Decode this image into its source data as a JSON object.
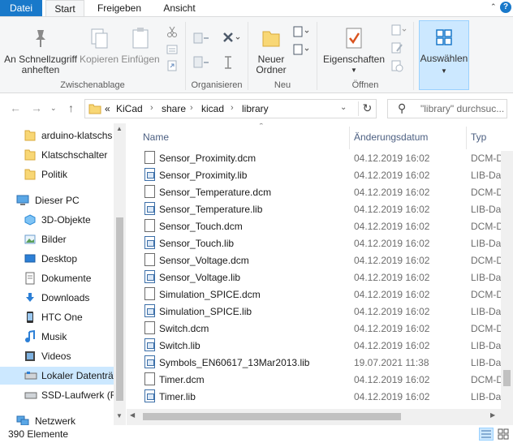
{
  "tabs": {
    "file": "Datei",
    "start": "Start",
    "share": "Freigeben",
    "view": "Ansicht"
  },
  "ribbon": {
    "pin": "An Schnellzugriff anheften",
    "copy": "Kopieren",
    "paste": "Einfügen",
    "clipboard_group": "Zwischenablage",
    "organize_group": "Organisieren",
    "new_folder": "Neuer Ordner",
    "new_group": "Neu",
    "properties": "Eigenschaften",
    "open_group": "Öffnen",
    "select": "Auswählen"
  },
  "address": {
    "overflow": "«",
    "crumbs": [
      "KiCad",
      "share",
      "kicad",
      "library"
    ],
    "search_placeholder": "\"library\" durchsuc..."
  },
  "nav": {
    "items": [
      {
        "label": "arduino-klatschs",
        "icon": "folder-icon"
      },
      {
        "label": "Klatschschalter",
        "icon": "folder-icon"
      },
      {
        "label": "Politik",
        "icon": "folder-icon"
      },
      {
        "label": "Dieser PC",
        "icon": "computer-icon"
      },
      {
        "label": "3D-Objekte",
        "icon": "cube-icon"
      },
      {
        "label": "Bilder",
        "icon": "pictures-icon"
      },
      {
        "label": "Desktop",
        "icon": "desktop-icon"
      },
      {
        "label": "Dokumente",
        "icon": "documents-icon"
      },
      {
        "label": "Downloads",
        "icon": "download-icon"
      },
      {
        "label": "HTC One",
        "icon": "phone-icon"
      },
      {
        "label": "Musik",
        "icon": "music-icon"
      },
      {
        "label": "Videos",
        "icon": "video-icon"
      },
      {
        "label": "Lokaler Datenträ",
        "icon": "drive-icon"
      },
      {
        "label": "SSD-Laufwerk (F",
        "icon": "drive-icon"
      },
      {
        "label": "Netzwerk",
        "icon": "network-icon"
      }
    ]
  },
  "columns": {
    "name": "Name",
    "date": "Änderungsdatum",
    "type": "Typ"
  },
  "files": [
    {
      "name": "Sensor_Proximity.dcm",
      "date": "04.12.2019 16:02",
      "type": "DCM-Datei",
      "kind": "dcm"
    },
    {
      "name": "Sensor_Proximity.lib",
      "date": "04.12.2019 16:02",
      "type": "LIB-Datei",
      "kind": "lib"
    },
    {
      "name": "Sensor_Temperature.dcm",
      "date": "04.12.2019 16:02",
      "type": "DCM-Datei",
      "kind": "dcm"
    },
    {
      "name": "Sensor_Temperature.lib",
      "date": "04.12.2019 16:02",
      "type": "LIB-Datei",
      "kind": "lib"
    },
    {
      "name": "Sensor_Touch.dcm",
      "date": "04.12.2019 16:02",
      "type": "DCM-Datei",
      "kind": "dcm"
    },
    {
      "name": "Sensor_Touch.lib",
      "date": "04.12.2019 16:02",
      "type": "LIB-Datei",
      "kind": "lib"
    },
    {
      "name": "Sensor_Voltage.dcm",
      "date": "04.12.2019 16:02",
      "type": "DCM-Datei",
      "kind": "dcm"
    },
    {
      "name": "Sensor_Voltage.lib",
      "date": "04.12.2019 16:02",
      "type": "LIB-Datei",
      "kind": "lib"
    },
    {
      "name": "Simulation_SPICE.dcm",
      "date": "04.12.2019 16:02",
      "type": "DCM-Datei",
      "kind": "dcm"
    },
    {
      "name": "Simulation_SPICE.lib",
      "date": "04.12.2019 16:02",
      "type": "LIB-Datei",
      "kind": "lib"
    },
    {
      "name": "Switch.dcm",
      "date": "04.12.2019 16:02",
      "type": "DCM-Datei",
      "kind": "dcm"
    },
    {
      "name": "Switch.lib",
      "date": "04.12.2019 16:02",
      "type": "LIB-Datei",
      "kind": "lib"
    },
    {
      "name": "Symbols_EN60617_13Mar2013.lib",
      "date": "19.07.2021 11:38",
      "type": "LIB-Datei",
      "kind": "lib"
    },
    {
      "name": "Timer.dcm",
      "date": "04.12.2019 16:02",
      "type": "DCM-Datei",
      "kind": "dcm"
    },
    {
      "name": "Timer.lib",
      "date": "04.12.2019 16:02",
      "type": "LIB-Datei",
      "kind": "lib"
    }
  ],
  "status": {
    "count": "390 Elemente"
  },
  "colors": {
    "accent": "#1979ca",
    "selection": "#cce8ff",
    "folder": "#f8d775"
  }
}
